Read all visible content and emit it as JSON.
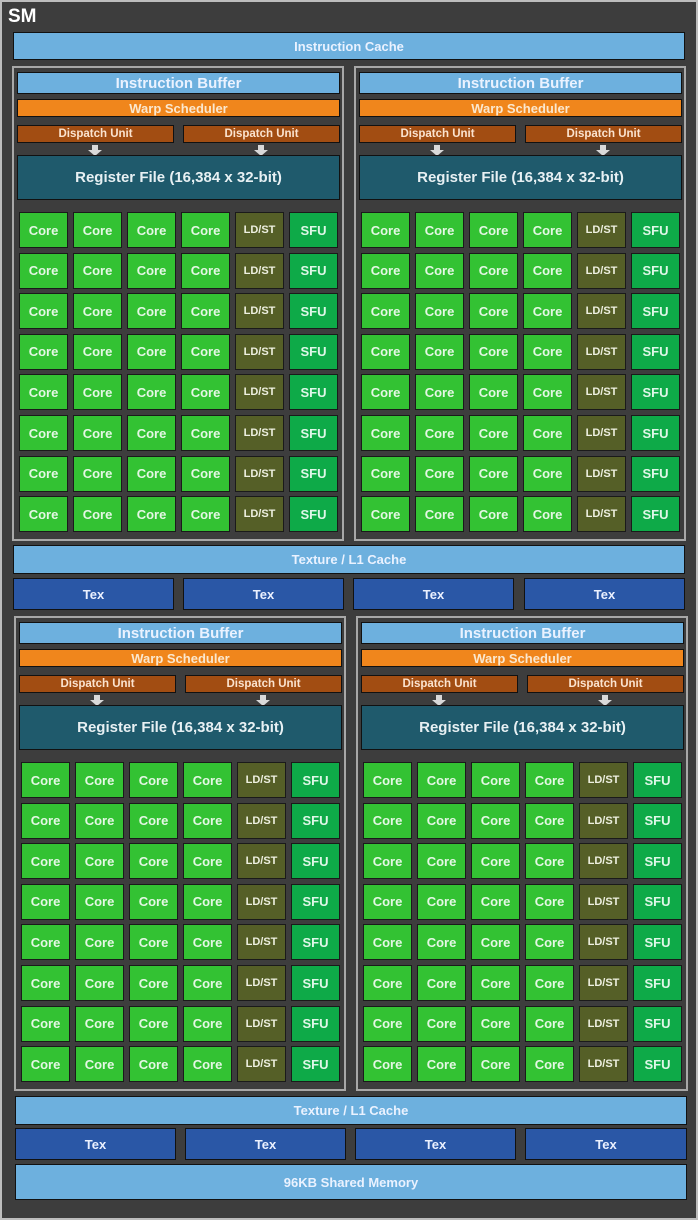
{
  "title": "SM",
  "instruction_cache": "Instruction Cache",
  "colors": {
    "background": "#3d3d3d",
    "cache_blue": "#6db0de",
    "tex_blue": "#2a57a6",
    "warp_orange": "#f0861c",
    "dispatch_brown": "#a24d12",
    "register_teal": "#1f5a6c",
    "core_green": "#33c233",
    "ldst_olive": "#555f27",
    "sfu_green": "#0eaa48"
  },
  "processing_block": {
    "instruction_buffer": "Instruction Buffer",
    "warp_scheduler": "Warp Scheduler",
    "dispatch_units": [
      "Dispatch Unit",
      "Dispatch Unit"
    ],
    "register_file": "Register File (16,384 x 32-bit)",
    "row_units": [
      "Core",
      "Core",
      "Core",
      "Core",
      "LD/ST",
      "SFU"
    ],
    "rows": 8
  },
  "blocks": [
    "top-left",
    "top-right",
    "bottom-left",
    "bottom-right"
  ],
  "texture_l1_cache": "Texture / L1 Cache",
  "tex_units": [
    "Tex",
    "Tex",
    "Tex",
    "Tex"
  ],
  "shared_memory": "96KB Shared Memory"
}
